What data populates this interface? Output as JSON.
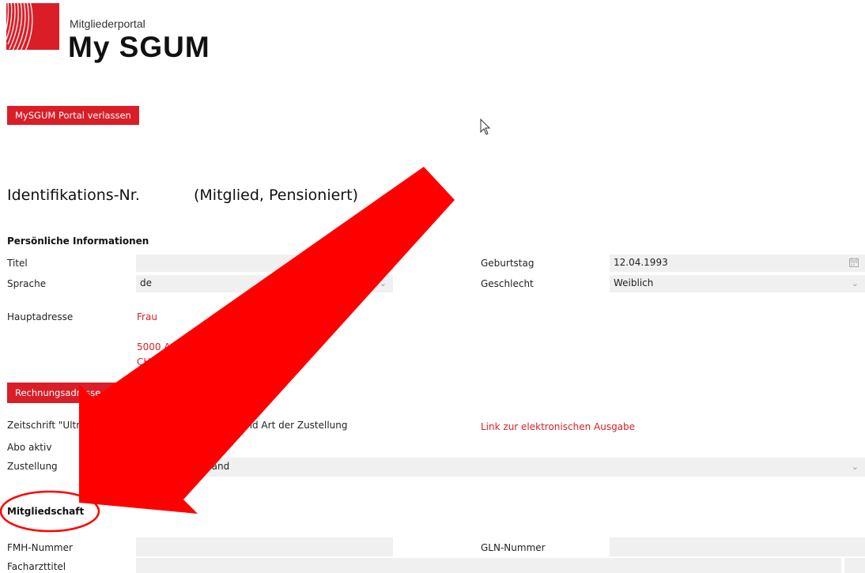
{
  "header": {
    "logo_small": "Mitgliederportal",
    "logo_big": "My SGUM",
    "leave_button": "MySGUM Portal verlassen"
  },
  "identity": {
    "heading_prefix": "Identifikations-Nr.",
    "heading_status": "(Mitglied, Pensioniert)"
  },
  "personal": {
    "section_title": "Persönliche Informationen",
    "title_label": "Titel",
    "title_value": "",
    "language_label": "Sprache",
    "language_value": "de",
    "birthday_label": "Geburtstag",
    "birthday_value": "12.04.1993",
    "gender_label": "Geschlecht",
    "gender_value": "Weiblich",
    "address_label": "Hauptadresse",
    "address_line1": "Frau",
    "address_city": "5000 Aarau",
    "address_country": "CH",
    "billing_button": "Rechnungsadresse erstellen"
  },
  "journal": {
    "label_start": "Zeitschrift \"Ultrasc",
    "label_mid": "der",
    "label_end": "nnement und Art der Zustellung",
    "link": "Link zur elektronischen Ausgabe",
    "abo_label": "Abo aktiv",
    "delivery_label": "Zustellung",
    "delivery_value": "stversand"
  },
  "membership": {
    "section_title": "Mitgliedschaft",
    "fmh_label": "FMH-Nummer",
    "fmh_value": "",
    "gln_label": "GLN-Nummer",
    "gln_value": "",
    "specialist_label": "Facharzttitel",
    "specialist_value": ""
  },
  "colors": {
    "brand_red": "#d91e28",
    "annotation_red": "#ff0000",
    "field_bg": "#f0f0f0"
  },
  "icons": {
    "chevron": "chevron-down-icon",
    "calendar": "calendar-icon",
    "cursor": "mouse-cursor-icon",
    "annotation": "red-arrow-annotation"
  }
}
